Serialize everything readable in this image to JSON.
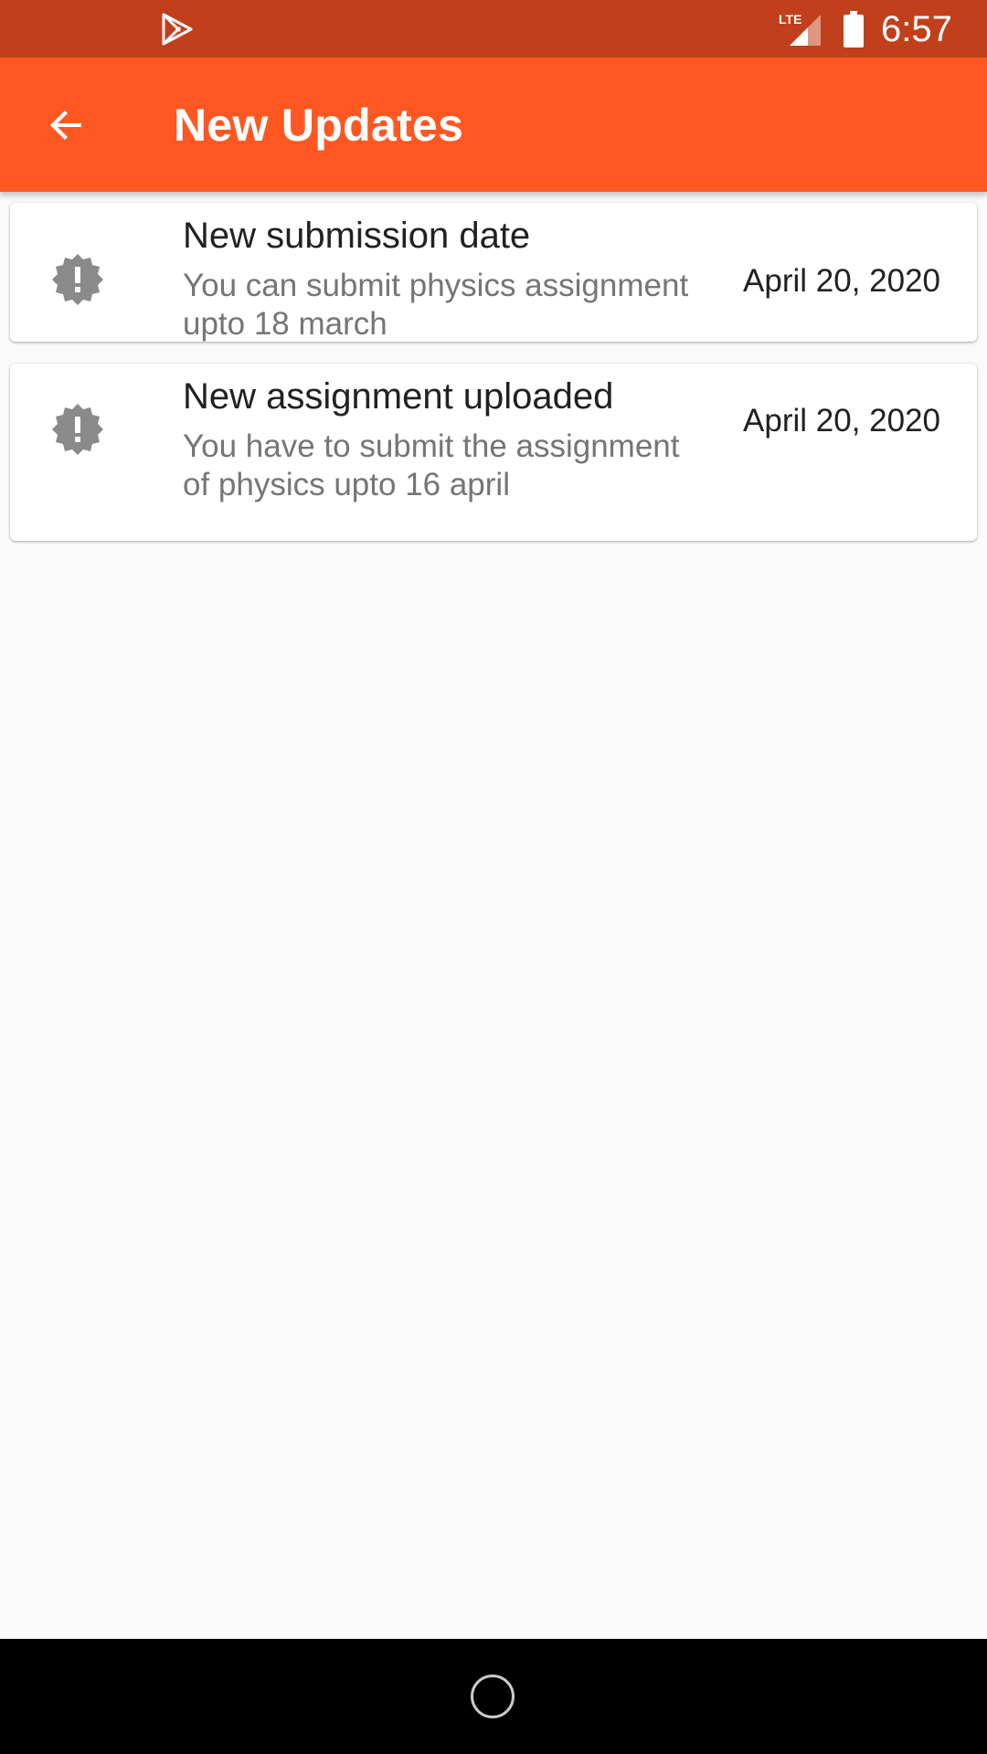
{
  "status_bar": {
    "time": "6:57",
    "network_label": "LTE",
    "icons": [
      "play-store-icon",
      "lte-signal-icon",
      "battery-icon"
    ]
  },
  "app_bar": {
    "title": "New Updates",
    "back_icon": "arrow-back-icon"
  },
  "updates": [
    {
      "title": "New submission date",
      "body": "You can submit physics assignment upto 18 march",
      "date": "April 20, 2020",
      "icon": "alert-badge-icon"
    },
    {
      "title": "New assignment uploaded",
      "body": "You have to submit the assignment of physics upto 16 april",
      "date": "April 20, 2020",
      "icon": "alert-badge-icon"
    }
  ],
  "nav_bar": {
    "home_icon": "home-circle-icon"
  },
  "colors": {
    "status_bar": "#c1401b",
    "app_bar": "#ff5722",
    "background": "#fafafa",
    "card": "#ffffff",
    "icon_gray": "#8a8a8a"
  }
}
